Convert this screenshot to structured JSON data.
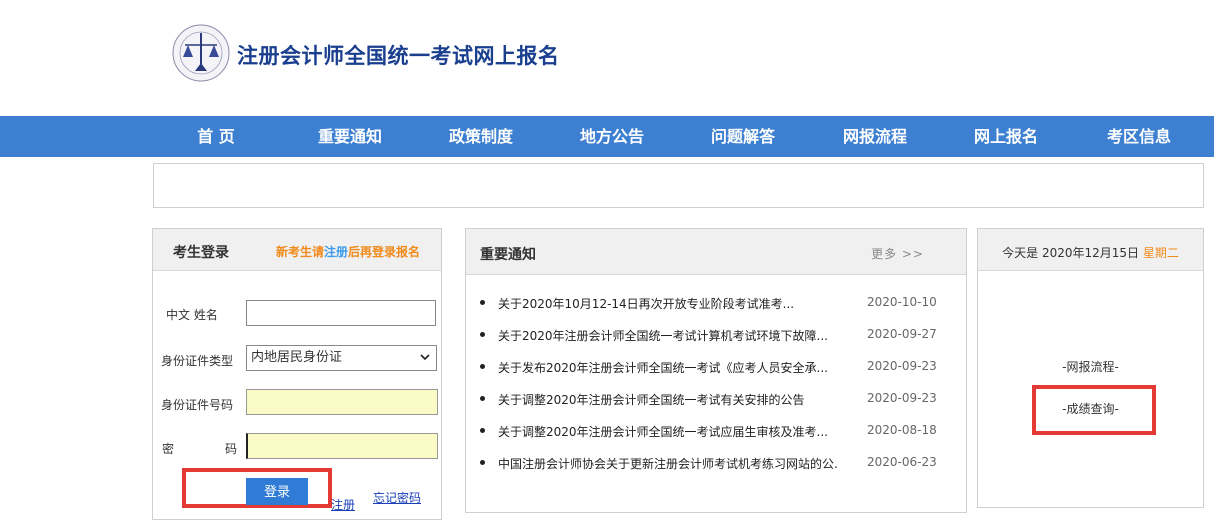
{
  "header": {
    "site_title": "注册会计师全国统一考试网上报名"
  },
  "nav": {
    "items": [
      "首 页",
      "重要通知",
      "政策制度",
      "地方公告",
      "问题解答",
      "网报流程",
      "网上报名",
      "考区信息"
    ]
  },
  "login": {
    "title": "考生登录",
    "tip_prefix": "新考生请",
    "tip_link": "注册",
    "tip_suffix": "后再登录报名",
    "name_label": "中文  姓名",
    "name_value": "",
    "idtype_label": "身份证件类型",
    "idtype_value": "内地居民身份证",
    "idno_label": "身份证件号码",
    "idno_value": "",
    "password_label_1": "密",
    "password_label_2": "码",
    "password_value": "",
    "login_button": "登录",
    "register_link": "注册",
    "forgot_link": "忘记密码"
  },
  "news": {
    "title": "重要通知",
    "more": "更多 >>",
    "items": [
      {
        "text": "关于2020年10月12-14日再次开放专业阶段考试准考...",
        "date": "2020-10-10"
      },
      {
        "text": "关于2020年注册会计师全国统一考试计算机考试环境下故障...",
        "date": "2020-09-27"
      },
      {
        "text": "关于发布2020年注册会计师全国统一考试《应考人员安全承...",
        "date": "2020-09-23"
      },
      {
        "text": "关于调整2020年注册会计师全国统一考试有关安排的公告",
        "date": "2020-09-23"
      },
      {
        "text": "关于调整2020年注册会计师全国统一考试应届生审核及准考...",
        "date": "2020-08-18"
      },
      {
        "text": "中国注册会计师协会关于更新注册会计师考试机考练习网站的公...",
        "date": "2020-06-23"
      }
    ]
  },
  "sidebar": {
    "date_prefix": "今天是 2020年12月15日",
    "weekday": "星期二",
    "process_link": "-网报流程-",
    "score_link": "-成绩查询-"
  },
  "colors": {
    "nav_bg": "#3d7fd1",
    "title": "#1a3f8f",
    "accent_orange": "#f08a1a",
    "highlight_red": "#e53935",
    "button_blue": "#2f7bd6"
  }
}
